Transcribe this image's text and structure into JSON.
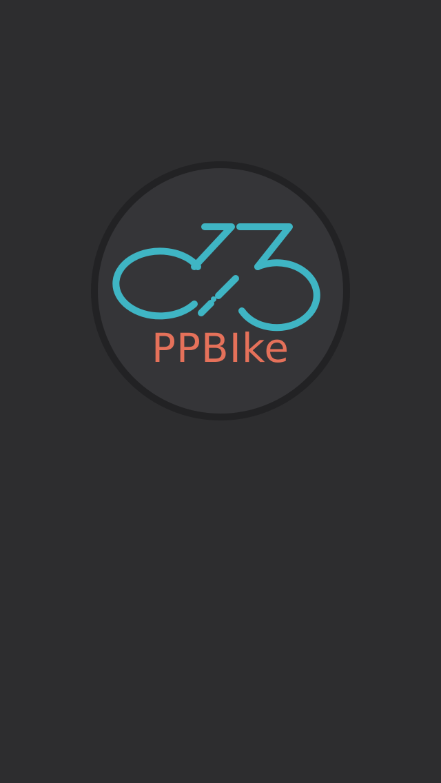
{
  "splash": {
    "brand_name": "PPBIke",
    "logo_icon": "bicycle-logo-icon"
  },
  "colors": {
    "background": "#2d2d2f",
    "badge_fill": "#353538",
    "badge_ring": "#222224",
    "logo_teal": "#3fb5c4",
    "brand_coral": "#e5715a"
  }
}
